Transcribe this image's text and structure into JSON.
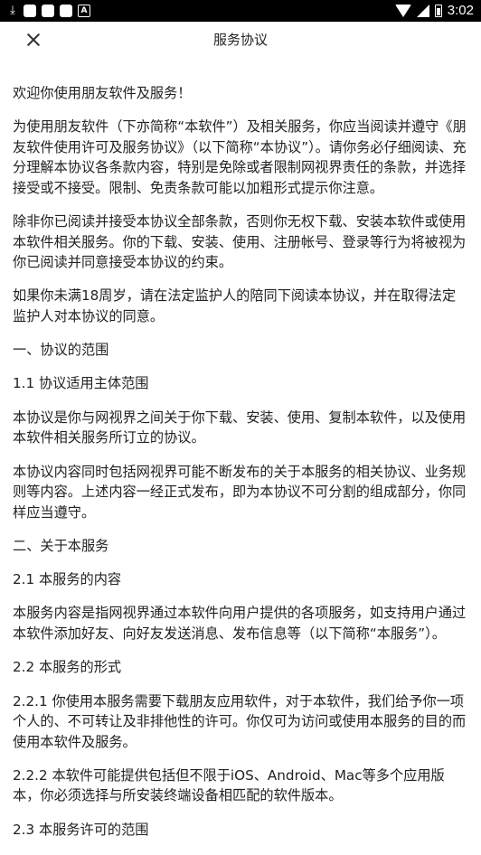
{
  "status_bar": {
    "download_glyph": "⤓",
    "notif_badge": "A",
    "time": "3:02"
  },
  "app_bar": {
    "title": "服务协议",
    "close_icon": "close-icon"
  },
  "paragraphs": [
    "欢迎你使用朋友软件及服务！",
    "为使用朋友软件（下亦简称“本软件”）及相关服务，你应当阅读并遵守《朋友软件使用许可及服务协议》（以下简称“本协议”）。请你务必仔细阅读、充分理解本协议各条款内容，特别是免除或者限制网视界责任的条款，并选择接受或不接受。限制、免责条款可能以加粗形式提示你注意。",
    "除非你已阅读并接受本协议全部条款，否则你无权下载、安装本软件或使用本软件相关服务。你的下载、安装、使用、注册帐号、登录等行为将被视为你已阅读并同意接受本协议的约束。",
    "如果你未满18周岁，请在法定监护人的陪同下阅读本协议，并在取得法定监护人对本协议的同意。",
    "一、协议的范围",
    "1.1 协议适用主体范围",
    "本协议是你与网视界之间关于你下载、安装、使用、复制本软件，以及使用本软件相关服务所订立的协议。",
    "本协议内容同时包括网视界可能不断发布的关于本服务的相关协议、业务规则等内容。上述内容一经正式发布，即为本协议不可分割的组成部分，你同样应当遵守。",
    "二、关于本服务",
    "2.1 本服务的内容",
    "本服务内容是指网视界通过本软件向用户提供的各项服务，如支持用户通过本软件添加好友、向好友发送消息、发布信息等（以下简称“本服务”）。",
    "2.2 本服务的形式",
    "2.2.1 你使用本服务需要下载朋友应用软件，对于本软件，我们给予你一项个人的、不可转让及非排他性的许可。你仅可为访问或使用本服务的目的而使用本软件及服务。",
    "2.2.2 本软件可能提供包括但不限于iOS、Android、Mac等多个应用版本，你必须选择与所安装终端设备相匹配的软件版本。",
    "2.3 本服务许可的范围"
  ]
}
